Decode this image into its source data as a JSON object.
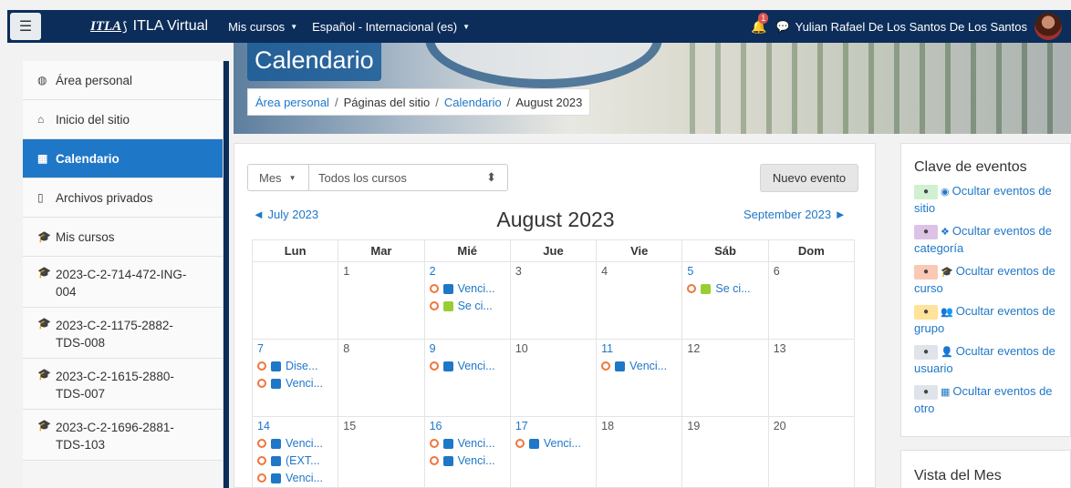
{
  "navbar": {
    "logo": "ITLA",
    "brand": "ITLA Virtual",
    "menu": [
      {
        "label": "Mis cursos"
      },
      {
        "label": "Español - Internacional (es)"
      }
    ],
    "notifications_count": "1",
    "user_name": "Yulian Rafael De Los Santos De Los Santos"
  },
  "sidebar": {
    "items": [
      {
        "label": "Área personal",
        "icon": "dashboard-icon"
      },
      {
        "label": "Inicio del sitio",
        "icon": "home-icon"
      },
      {
        "label": "Calendario",
        "icon": "calendar-icon",
        "active": true
      },
      {
        "label": "Archivos privados",
        "icon": "file-icon"
      },
      {
        "label": "Mis cursos",
        "icon": "graduation-cap-icon"
      }
    ],
    "courses": [
      {
        "label": "2023-C-2-714-472-ING-004"
      },
      {
        "label": "2023-C-2-1175-2882-TDS-008"
      },
      {
        "label": "2023-C-2-1615-2880-TDS-007"
      },
      {
        "label": "2023-C-2-1696-2881-TDS-103"
      }
    ]
  },
  "header": {
    "title": "Calendario",
    "breadcrumb": [
      "Área personal",
      "Páginas del sitio",
      "Calendario",
      "August 2023"
    ]
  },
  "calendar": {
    "view_select": "Mes",
    "course_select": "Todos los cursos",
    "new_event_label": "Nuevo evento",
    "prev_month": "July 2023",
    "next_month": "September 2023",
    "month_title": "August 2023",
    "weekdays": [
      "Lun",
      "Mar",
      "Mié",
      "Jue",
      "Vie",
      "Sáb",
      "Dom"
    ],
    "weeks": [
      [
        {
          "day": "",
          "events": []
        },
        {
          "day": "1",
          "events": []
        },
        {
          "day": "2",
          "link": true,
          "events": [
            {
              "label": "Venci...",
              "icon": "blue"
            },
            {
              "label": "Se ci...",
              "icon": "green"
            }
          ]
        },
        {
          "day": "3",
          "events": []
        },
        {
          "day": "4",
          "events": []
        },
        {
          "day": "5",
          "link": true,
          "events": [
            {
              "label": "Se ci...",
              "icon": "green"
            }
          ]
        },
        {
          "day": "6",
          "events": []
        }
      ],
      [
        {
          "day": "7",
          "link": true,
          "events": [
            {
              "label": "Dise...",
              "icon": "blue"
            },
            {
              "label": "Venci...",
              "icon": "blue"
            }
          ]
        },
        {
          "day": "8",
          "events": []
        },
        {
          "day": "9",
          "link": true,
          "events": [
            {
              "label": "Venci...",
              "icon": "blue"
            }
          ]
        },
        {
          "day": "10",
          "events": []
        },
        {
          "day": "11",
          "link": true,
          "events": [
            {
              "label": "Venci...",
              "icon": "blue"
            }
          ]
        },
        {
          "day": "12",
          "events": []
        },
        {
          "day": "13",
          "events": []
        }
      ],
      [
        {
          "day": "14",
          "link": true,
          "events": [
            {
              "label": "Venci...",
              "icon": "blue"
            },
            {
              "label": "(EXT...",
              "icon": "blue"
            },
            {
              "label": "Venci...",
              "icon": "blue"
            }
          ]
        },
        {
          "day": "15",
          "events": []
        },
        {
          "day": "16",
          "link": true,
          "events": [
            {
              "label": "Venci...",
              "icon": "blue"
            },
            {
              "label": "Venci...",
              "icon": "blue"
            }
          ]
        },
        {
          "day": "17",
          "link": true,
          "events": [
            {
              "label": "Venci...",
              "icon": "blue"
            }
          ]
        },
        {
          "day": "18",
          "events": []
        },
        {
          "day": "19",
          "events": []
        },
        {
          "day": "20",
          "events": []
        }
      ]
    ]
  },
  "event_key": {
    "title": "Clave de eventos",
    "items": [
      {
        "label": "Ocultar eventos de sitio",
        "icon": "globe-icon",
        "color": "#d1f0d1"
      },
      {
        "label": "Ocultar eventos de categoría",
        "icon": "cubes-icon",
        "color": "#dcc3e6"
      },
      {
        "label": "Ocultar eventos de curso",
        "icon": "graduation-cap-icon",
        "color": "#fbc8b4"
      },
      {
        "label": "Ocultar eventos de grupo",
        "icon": "group-icon",
        "color": "#ffe39a"
      },
      {
        "label": "Ocultar eventos de usuario",
        "icon": "user-icon",
        "color": "#dfe4ea"
      },
      {
        "label": "Ocultar eventos de otro",
        "icon": "calendar-icon",
        "color": "#dfe4ea"
      }
    ]
  },
  "month_view": {
    "title": "Vista del Mes"
  },
  "colors": {
    "navbar": "#0c2d5a",
    "accent": "#1f77c8",
    "event_dot": "#f0763d"
  }
}
